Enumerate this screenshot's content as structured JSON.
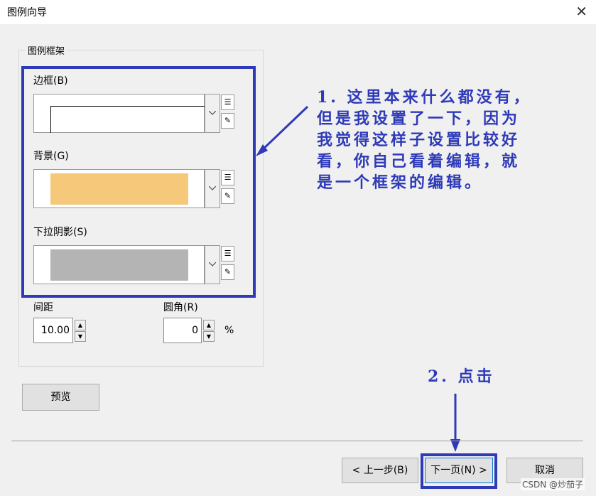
{
  "window": {
    "title": "图例向导",
    "close_glyph": "✕"
  },
  "groupbox": {
    "title": "图例框架"
  },
  "border": {
    "label": "边框(B)"
  },
  "background": {
    "label": "背景(G)",
    "color": "#f5c87a"
  },
  "shadow": {
    "label": "下拉阴影(S)",
    "color": "#b4b4b4"
  },
  "spacing": {
    "label": "间距",
    "value": "10.00"
  },
  "corner": {
    "label": "圆角(R)",
    "value": "0",
    "unit": "%"
  },
  "preview_button": "预览",
  "nav": {
    "back": "< 上一步(B)",
    "next": "下一页(N) >",
    "cancel": "取消"
  },
  "annotation1": {
    "lines": [
      "1. 这里本来什么都没有，",
      "但是我设置了一下，因为",
      "我觉得这样子设置比较好",
      "看，你自己看着编辑，就",
      "是一个框架的编辑。"
    ]
  },
  "annotation2": "2. 点击",
  "annotation_color": "#2e3ab8",
  "watermark": "CSDN @炒茄子"
}
